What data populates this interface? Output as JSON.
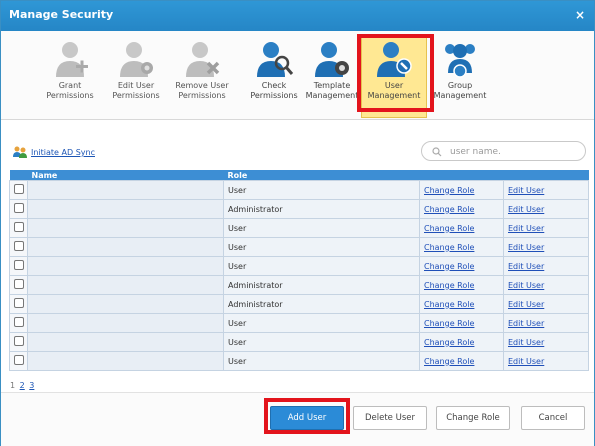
{
  "dialog": {
    "title": "Manage Security",
    "close_label": "×"
  },
  "toolbar": {
    "items": [
      {
        "label": "Grant\nPermissions",
        "icon": "grant-permissions-icon",
        "active": false
      },
      {
        "label": "Edit User\nPermissions",
        "icon": "edit-user-permissions-icon",
        "active": false
      },
      {
        "label": "Remove User\nPermissions",
        "icon": "remove-user-permissions-icon",
        "active": false
      },
      {
        "label": "Check\nPermissions",
        "icon": "check-permissions-icon",
        "active": false
      },
      {
        "label": "Template\nManagement",
        "icon": "template-management-icon",
        "active": false
      },
      {
        "label": "User\nManagement",
        "icon": "user-management-icon",
        "active": true
      },
      {
        "label": "Group\nManagement",
        "icon": "group-management-icon",
        "active": false
      }
    ]
  },
  "sync_link": "Initiate AD Sync",
  "search": {
    "placeholder": "user name."
  },
  "table": {
    "columns": [
      "",
      "Name",
      "Role",
      "",
      ""
    ],
    "rows": [
      {
        "name": "",
        "role": "User",
        "action1": "Change Role",
        "action2": "Edit User"
      },
      {
        "name": "",
        "role": "Administrator",
        "action1": "Change Role",
        "action2": "Edit User"
      },
      {
        "name": "",
        "role": "User",
        "action1": "Change Role",
        "action2": "Edit User"
      },
      {
        "name": "",
        "role": "User",
        "action1": "Change Role",
        "action2": "Edit User"
      },
      {
        "name": "",
        "role": "User",
        "action1": "Change Role",
        "action2": "Edit User"
      },
      {
        "name": "",
        "role": "Administrator",
        "action1": "Change Role",
        "action2": "Edit User"
      },
      {
        "name": "",
        "role": "Administrator",
        "action1": "Change Role",
        "action2": "Edit User"
      },
      {
        "name": "",
        "role": "User",
        "action1": "Change Role",
        "action2": "Edit User"
      },
      {
        "name": "",
        "role": "User",
        "action1": "Change Role",
        "action2": "Edit User"
      },
      {
        "name": "",
        "role": "User",
        "action1": "Change Role",
        "action2": "Edit User"
      }
    ]
  },
  "pager": {
    "current": "1",
    "pages": [
      "2",
      "3"
    ]
  },
  "buttons": {
    "add_user": "Add User",
    "delete_user": "Delete User",
    "change_role": "Change Role",
    "cancel": "Cancel"
  },
  "colors": {
    "title_bar": "#2586c6",
    "header": "#3d8ed4",
    "highlight": "#e3141c",
    "active_tool": "#ffe893",
    "primary_button": "#2b8bd7"
  }
}
